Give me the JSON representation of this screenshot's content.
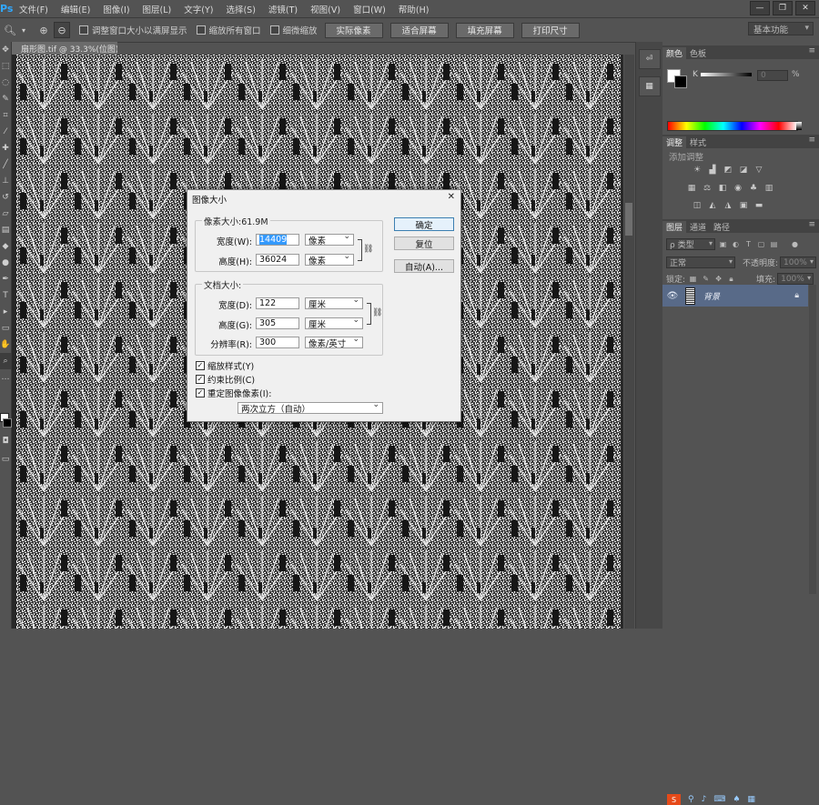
{
  "app": {
    "logo": "Ps"
  },
  "menu": [
    "文件(F)",
    "编辑(E)",
    "图像(I)",
    "图层(L)",
    "文字(Y)",
    "选择(S)",
    "滤镜(T)",
    "视图(V)",
    "窗口(W)",
    "帮助(H)"
  ],
  "window_controls": {
    "minimize": "—",
    "restore": "❐",
    "close": "✕"
  },
  "options_bar": {
    "check_resize": "调整窗口大小以满屏显示",
    "check_zoom_all": "缩放所有窗口",
    "check_scrubby": "细微缩放",
    "btn_actual": "实际像素",
    "btn_fit": "适合屏幕",
    "btn_fill": "填充屏幕",
    "btn_print": "打印尺寸",
    "workspace": "基本功能"
  },
  "document": {
    "tab_title": "扇形图.tif @ 33.3%(位图)"
  },
  "panels": {
    "color_tabs": [
      "颜色",
      "色板"
    ],
    "color": {
      "k_label": "K",
      "k_value": "0",
      "pct": "%"
    },
    "adjust_tabs": [
      "调整",
      "样式"
    ],
    "adjust_title": "添加调整",
    "layers_tabs": [
      "图层",
      "通道",
      "路径"
    ],
    "layers": {
      "filter": "ρ 类型",
      "blend_mode": "正常",
      "opacity_label": "不透明度:",
      "opacity_value": "100%",
      "lock_label": "锁定:",
      "fill_label": "填充:",
      "fill_value": "100%",
      "layer_name": "背景"
    },
    "badge": "S"
  },
  "dialog": {
    "title": "图像大小",
    "close": "✕",
    "pixel_group": "像素大小:61.9M",
    "width_label": "宽度(W):",
    "width_value": "14409",
    "height_label": "高度(H):",
    "height_value": "36024",
    "pixel_unit": "像素",
    "doc_group": "文档大小:",
    "doc_width_label": "宽度(D):",
    "doc_width_value": "122",
    "doc_height_label": "高度(G):",
    "doc_height_value": "305",
    "res_label": "分辨率(R):",
    "res_value": "300",
    "cm_unit": "厘米",
    "res_unit": "像素/英寸",
    "ok": "确定",
    "reset": "复位",
    "auto": "自动(A)...",
    "check_scale": "缩放样式(Y)",
    "check_constrain": "约束比例(C)",
    "check_resample": "重定图像像素(I):",
    "resample_method": "两次立方（自动）",
    "check_mark": "✓"
  }
}
